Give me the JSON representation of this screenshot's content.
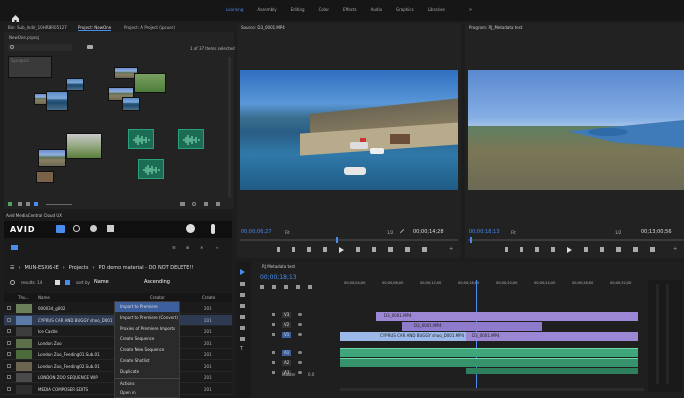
{
  "topbar": {
    "workspaces": [
      "Learning",
      "Assembly",
      "Editing",
      "Color",
      "Effects",
      "Audio",
      "Graphics",
      "Libraries"
    ],
    "active": "Learning",
    "more": "»"
  },
  "project": {
    "tabs": [
      "Bin: Sub_Indir_10HRBR05127",
      "Project: NewOne",
      "Project: A Project (ipcuer)"
    ],
    "file": "NewOne.prproj",
    "count": "1 of 37 Items selected",
    "search_placeholder": "",
    "thumb_label": "Synopsis"
  },
  "source": {
    "title": "Source: D3_0001.MP4",
    "timecode": "00;00;06;27",
    "fit": "Fit",
    "ratio": "1/2",
    "duration": "00;00;14;28"
  },
  "program": {
    "title": "Program: RJ_Metadata test",
    "timecode": "00;00;18;13",
    "fit": "Fit",
    "ratio": "1/2",
    "duration": "00;13;00;56"
  },
  "avid": {
    "title": "Avid MediaCentral Cloud UX",
    "logo": "AVID",
    "breadcrumb": [
      "MUN-ESXi6-IE",
      "Projects",
      "PD demo material - DO NOT DELETE!!"
    ],
    "results": "results: 14",
    "sort_by": "sort by",
    "sort_field": "Name",
    "sort_dir": "Ascending",
    "columns": [
      "Thu...",
      "Name",
      "Creator",
      "Create"
    ],
    "rows": [
      {
        "name": "000034_g002",
        "creator": "",
        "date": "201"
      },
      {
        "name": "CYPRUS CAR AND BUGGY shoo_D001",
        "creator": "",
        "date": "201"
      },
      {
        "name": "Ice Castle",
        "creator": "",
        "date": "201"
      },
      {
        "name": "London Zoo",
        "creator": "",
        "date": "201"
      },
      {
        "name": "London Zoo_Feeding01.Sub.01",
        "creator": "",
        "date": "201"
      },
      {
        "name": "London Zoo_Feeding02.Sub.01",
        "creator": "",
        "date": "201"
      },
      {
        "name": "LONDON ZOO SEQUENCE WIP",
        "creator": "",
        "date": "201"
      },
      {
        "name": "MEDIA COMPOSER EDITS",
        "creator": "",
        "date": "201"
      }
    ],
    "context_menu": [
      "Import to Premiere",
      "Import to Premiere (Convert)",
      "Proxies of Premiere Imports",
      "Create Sequence",
      "Create New Sequence",
      "Create Shotlist",
      "Duplicate",
      "Actions",
      "Open in"
    ]
  },
  "timeline": {
    "title": "RJ Metadata test",
    "timecode": "00;00;18;13",
    "ruler": [
      "00;00;04;00",
      "00;00;08;00",
      "00;00;12;00",
      "00;00;16;00",
      "00;00;20;00",
      "00;00;24;00",
      "00;00;28;00",
      "00;00;32;00"
    ],
    "tracks": [
      "V3",
      "V2",
      "V1",
      "A1",
      "A2",
      "A3"
    ],
    "clips": [
      "D3_0001.MP4",
      "D3_0001.MP4",
      "CYPRUS CAR AND BUGGY shoo_D001.MP4",
      "D3_0001.MP4"
    ],
    "master": "Master",
    "master_val": "0.0"
  }
}
